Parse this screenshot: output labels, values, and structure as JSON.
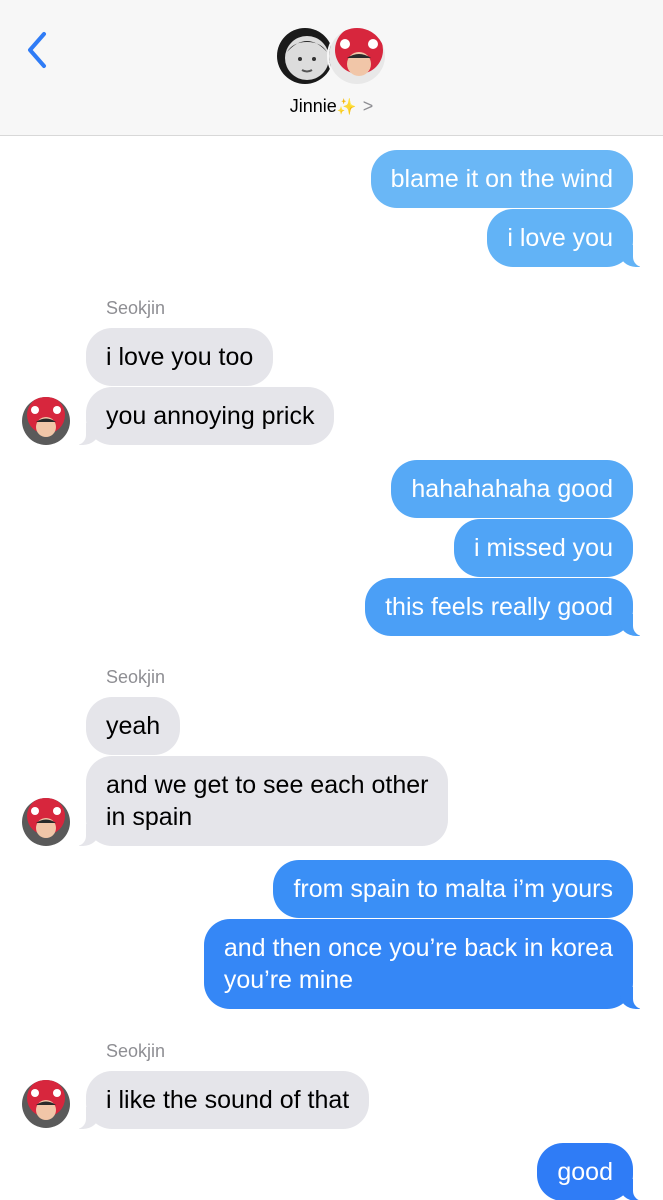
{
  "header": {
    "contact_name": "Jinnie",
    "sparkle": "✨",
    "chevron": ">",
    "back_icon": "chevron-left-icon"
  },
  "colors": {
    "sent_top": "#5fb2f6",
    "sent_bottom": "#2f7cf6",
    "received": "#e5e5ea",
    "back_blue": "#2f7cf6"
  },
  "messages": [
    {
      "from": "me",
      "text": "blame it on the wind"
    },
    {
      "from": "me",
      "text": "i love you"
    },
    {
      "from": "Seokjin",
      "sender_label": "Seokjin"
    },
    {
      "from": "Seokjin",
      "text": "i love you too"
    },
    {
      "from": "Seokjin",
      "text": "you annoying prick"
    },
    {
      "from": "me",
      "text": "hahahahaha good"
    },
    {
      "from": "me",
      "text": "i missed you"
    },
    {
      "from": "me",
      "text": "this feels really good"
    },
    {
      "from": "Seokjin",
      "sender_label": "Seokjin"
    },
    {
      "from": "Seokjin",
      "text": "yeah"
    },
    {
      "from": "Seokjin",
      "text_lines": [
        "and we get to see each other",
        "in spain"
      ]
    },
    {
      "from": "me",
      "text": "from spain to malta i’m yours"
    },
    {
      "from": "me",
      "text_lines": [
        "and then once you’re back in korea",
        "you’re mine"
      ]
    },
    {
      "from": "Seokjin",
      "sender_label": "Seokjin"
    },
    {
      "from": "Seokjin",
      "text": "i like the sound of that"
    },
    {
      "from": "me",
      "text": "good"
    }
  ]
}
